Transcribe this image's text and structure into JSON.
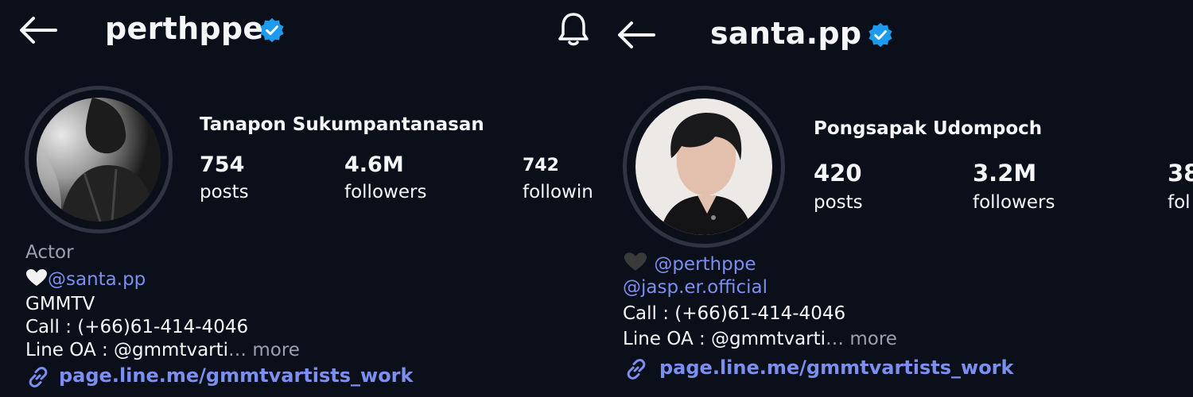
{
  "left": {
    "username": "perthppe",
    "fullname": "Tanapon Sukumpantanasan",
    "stats": {
      "posts": {
        "value": "754",
        "label": "posts"
      },
      "followers": {
        "value": "4.6M",
        "label": "followers"
      },
      "following": {
        "value": "742",
        "label": "followin"
      }
    },
    "bio": {
      "category": "Actor",
      "line1_mention": "@santa.pp",
      "line2": "GMMTV",
      "line3": "Call : (+66)61-414-4046",
      "line4_prefix": "Line OA : ",
      "line4_handle": "@gmmtvarti",
      "line4_ellipsis": "… ",
      "more": "more"
    },
    "link": "page.line.me/gmmtvartists_work"
  },
  "right": {
    "username": "santa.pp",
    "fullname": "Pongsapak Udompoch",
    "stats": {
      "posts": {
        "value": "420",
        "label": "posts"
      },
      "followers": {
        "value": "3.2M",
        "label": "followers"
      },
      "following": {
        "value": "38",
        "label": "fol"
      }
    },
    "bio": {
      "line1_mention": "@perthppe",
      "line2_mention": "@jasp.er.official",
      "line3": "Call : (+66)61-414-4046",
      "line4_prefix": "Line OA : ",
      "line4_handle": "@gmmtvarti",
      "line4_ellipsis": "… ",
      "more": "more"
    },
    "link": "page.line.me/gmmtvartists_work"
  },
  "colors": {
    "background": "#0b0f1a",
    "text": "#f5f6f8",
    "muted": "#9aa0ad",
    "link": "#7b8ff0",
    "verified": "#1d9bf0"
  },
  "icons": [
    "back-arrow-icon",
    "verified-badge-icon",
    "bell-icon",
    "white-heart-icon",
    "black-heart-icon",
    "threads-icon",
    "link-icon"
  ]
}
